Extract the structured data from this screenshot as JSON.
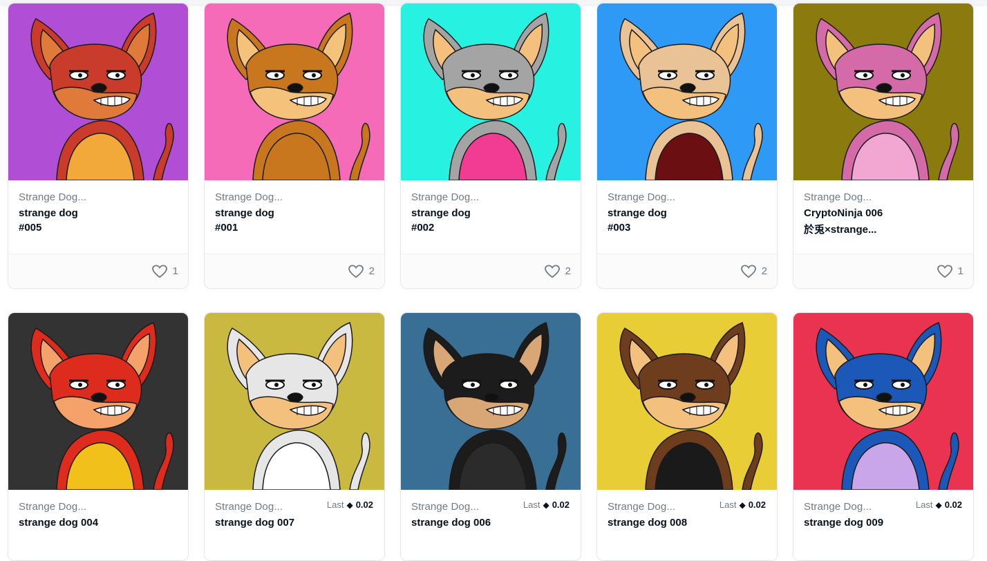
{
  "cards": [
    {
      "collection": "Strange Dog...",
      "name1": "strange dog",
      "name2": "#005",
      "likes": "1",
      "bg": "#b04fd6",
      "fur": "#c93b2b",
      "fur2": "#e07a3a",
      "outfit": "#f3a83a",
      "has_price": false
    },
    {
      "collection": "Strange Dog...",
      "name1": "strange dog",
      "name2": "#001",
      "likes": "2",
      "bg": "#f56bb8",
      "fur": "#c9771f",
      "fur2": "#f4c27a",
      "outfit": "#c9771f",
      "has_price": false
    },
    {
      "collection": "Strange Dog...",
      "name1": "strange dog",
      "name2": "#002",
      "likes": "2",
      "bg": "#27f2e2",
      "fur": "#a4a4a4",
      "fur2": "#f4c07e",
      "outfit": "#f23c93",
      "has_price": false
    },
    {
      "collection": "Strange Dog...",
      "name1": "strange dog",
      "name2": "#003",
      "likes": "2",
      "bg": "#2f9af5",
      "fur": "#e9c296",
      "fur2": "#f4c07e",
      "outfit": "#6b0f12",
      "has_price": false
    },
    {
      "collection": "Strange Dog...",
      "name1": "CryptoNinja 006",
      "name2": "於兎×strange...",
      "likes": "1",
      "bg": "#8b7a0d",
      "fur": "#d46aa8",
      "fur2": "#f4c07e",
      "outfit": "#f2a6d2",
      "has_price": false
    },
    {
      "collection": "Strange Dog...",
      "name1": "strange dog 004",
      "name2": "",
      "likes": "",
      "bg": "#333333",
      "fur": "#dd2c1e",
      "fur2": "#f4a26a",
      "outfit": "#f1c01a",
      "has_price": false,
      "last_label": "",
      "price_value": ""
    },
    {
      "collection": "Strange Dog...",
      "name1": "strange dog 007",
      "name2": "",
      "likes": "",
      "bg": "#c9b941",
      "fur": "#e6e6e6",
      "fur2": "#f4c07e",
      "outfit": "#ffffff",
      "has_price": true,
      "last_label": "Last",
      "price_value": "0.02"
    },
    {
      "collection": "Strange Dog...",
      "name1": "strange dog 006",
      "name2": "",
      "likes": "",
      "bg": "#3a6f95",
      "fur": "#1c1c1c",
      "fur2": "#d9a676",
      "outfit": "#2b2b2b",
      "has_price": true,
      "last_label": "Last",
      "price_value": "0.02"
    },
    {
      "collection": "Strange Dog...",
      "name1": "strange dog 008",
      "name2": "",
      "likes": "",
      "bg": "#e8cd37",
      "fur": "#6e3d1e",
      "fur2": "#f4c07e",
      "outfit": "#1a1a1a",
      "has_price": true,
      "last_label": "Last",
      "price_value": "0.02"
    },
    {
      "collection": "Strange Dog...",
      "name1": "strange dog 009",
      "name2": "",
      "likes": "",
      "bg": "#ea3350",
      "fur": "#1b58b8",
      "fur2": "#f4c07e",
      "outfit": "#c9a6ea",
      "has_price": true,
      "last_label": "Last",
      "price_value": "0.02"
    }
  ],
  "icons": {
    "like": "heart-outline-icon",
    "currency": "ethereum-icon"
  }
}
